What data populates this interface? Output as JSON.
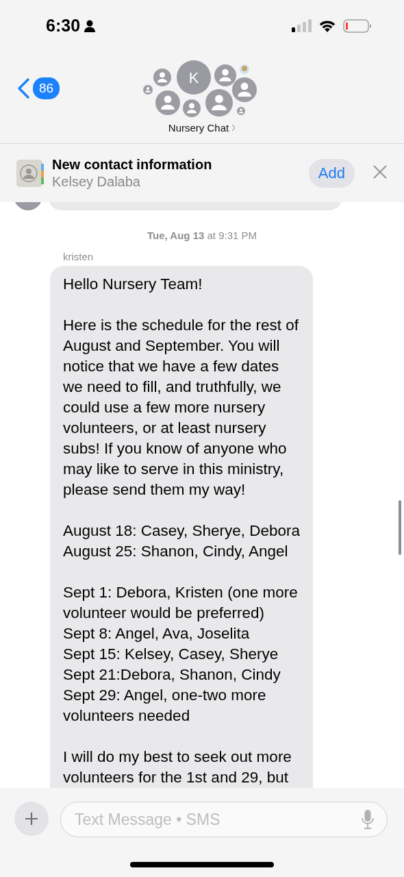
{
  "status_bar": {
    "time": "6:30"
  },
  "header": {
    "back_count": "86",
    "avatar_initial": "K",
    "title": "Nursery Chat"
  },
  "contact_banner": {
    "title": "New contact information",
    "name": "Kelsey Dalaba",
    "action": "Add"
  },
  "messages": [
    {
      "timestamp": "**Tue, Aug 13** at 9:31 PM",
      "sender": "kristen",
      "paragraphs": [
        [
          "Hello Nursery Team!"
        ],
        [
          "Here is the schedule for the rest of",
          "August and September. You will",
          "notice that we have a few dates",
          "we need to fill, and truthfully, we",
          "could use a few more nursery",
          "volunteers, or at least nursery",
          "subs! If you know of anyone who",
          "may like to serve in this ministry,",
          "please send them my way!"
        ],
        [
          "August 18: Casey, Sherye, Debora",
          "August 25: Shanon, Cindy, Angel"
        ],
        [
          "Sept 1: Debora, Kristen (one more",
          "volunteer would be preferred)",
          "Sept 8: Angel, Ava, Joselita",
          "Sept 15: Kelsey, Casey, Sherye",
          "Sept 21:Debora, Shanon, Cindy",
          "Sept 29: Angel, one-two more",
          "volunteers needed"
        ],
        [
          "I will do my best to seek out more",
          "volunteers for the 1st and 29, but"
        ]
      ]
    }
  ],
  "composer": {
    "placeholder": "Text Message • SMS"
  }
}
